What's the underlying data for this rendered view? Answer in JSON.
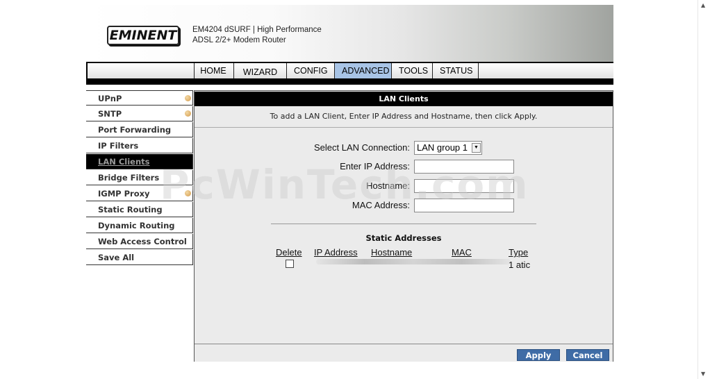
{
  "header": {
    "logo_text": "EMINENT",
    "product_line1_model": "EM4204 dSURF",
    "product_line1_sep": " | ",
    "product_line1_rest": "High Performance",
    "product_line2": "ADSL 2/2+ Modem Router"
  },
  "nav": {
    "tabs": [
      {
        "label": "HOME"
      },
      {
        "label": "WIZARD"
      },
      {
        "label": "CONFIG"
      },
      {
        "label": "ADVANCED",
        "active": true
      },
      {
        "label": "TOOLS"
      },
      {
        "label": "STATUS"
      }
    ]
  },
  "sidebar": {
    "items": [
      {
        "label": "UPnP",
        "dot": true
      },
      {
        "label": "SNTP",
        "dot": true
      },
      {
        "label": "Port Forwarding"
      },
      {
        "label": "IP Filters"
      },
      {
        "label": "LAN Clients",
        "active": true
      },
      {
        "label": "Bridge Filters"
      },
      {
        "label": "IGMP Proxy",
        "dot": true
      },
      {
        "label": "Static Routing"
      },
      {
        "label": "Dynamic Routing"
      },
      {
        "label": "Web Access Control"
      },
      {
        "label": "Save All"
      }
    ]
  },
  "content": {
    "title": "LAN Clients",
    "description": "To add a LAN Client, Enter IP Address and Hostname, then click Apply.",
    "fields": {
      "lan_connection_label": "Select LAN Connection:",
      "lan_connection_value": "LAN group 1",
      "ip_label": "Enter IP Address:",
      "ip_value": "",
      "hostname_label": "Hostname:",
      "hostname_value": "",
      "mac_label": "MAC Address:",
      "mac_value": ""
    },
    "static_addresses": {
      "title": "Static Addresses",
      "columns": [
        "Delete",
        "IP Address",
        "Hostname",
        "MAC",
        "Type"
      ],
      "rows": [
        {
          "type": "static",
          "type_display": "1 atic"
        }
      ]
    },
    "buttons": {
      "apply": "Apply",
      "cancel": "Cancel"
    }
  },
  "watermark": "PcWinTech.com",
  "colors": {
    "active_tab": "#a8c4e6",
    "button_bg": "#3f6ca6",
    "sidebar_active_bg": "#000000",
    "content_bg": "#ebebeb",
    "sidebar_dot": "#d49a4a"
  }
}
